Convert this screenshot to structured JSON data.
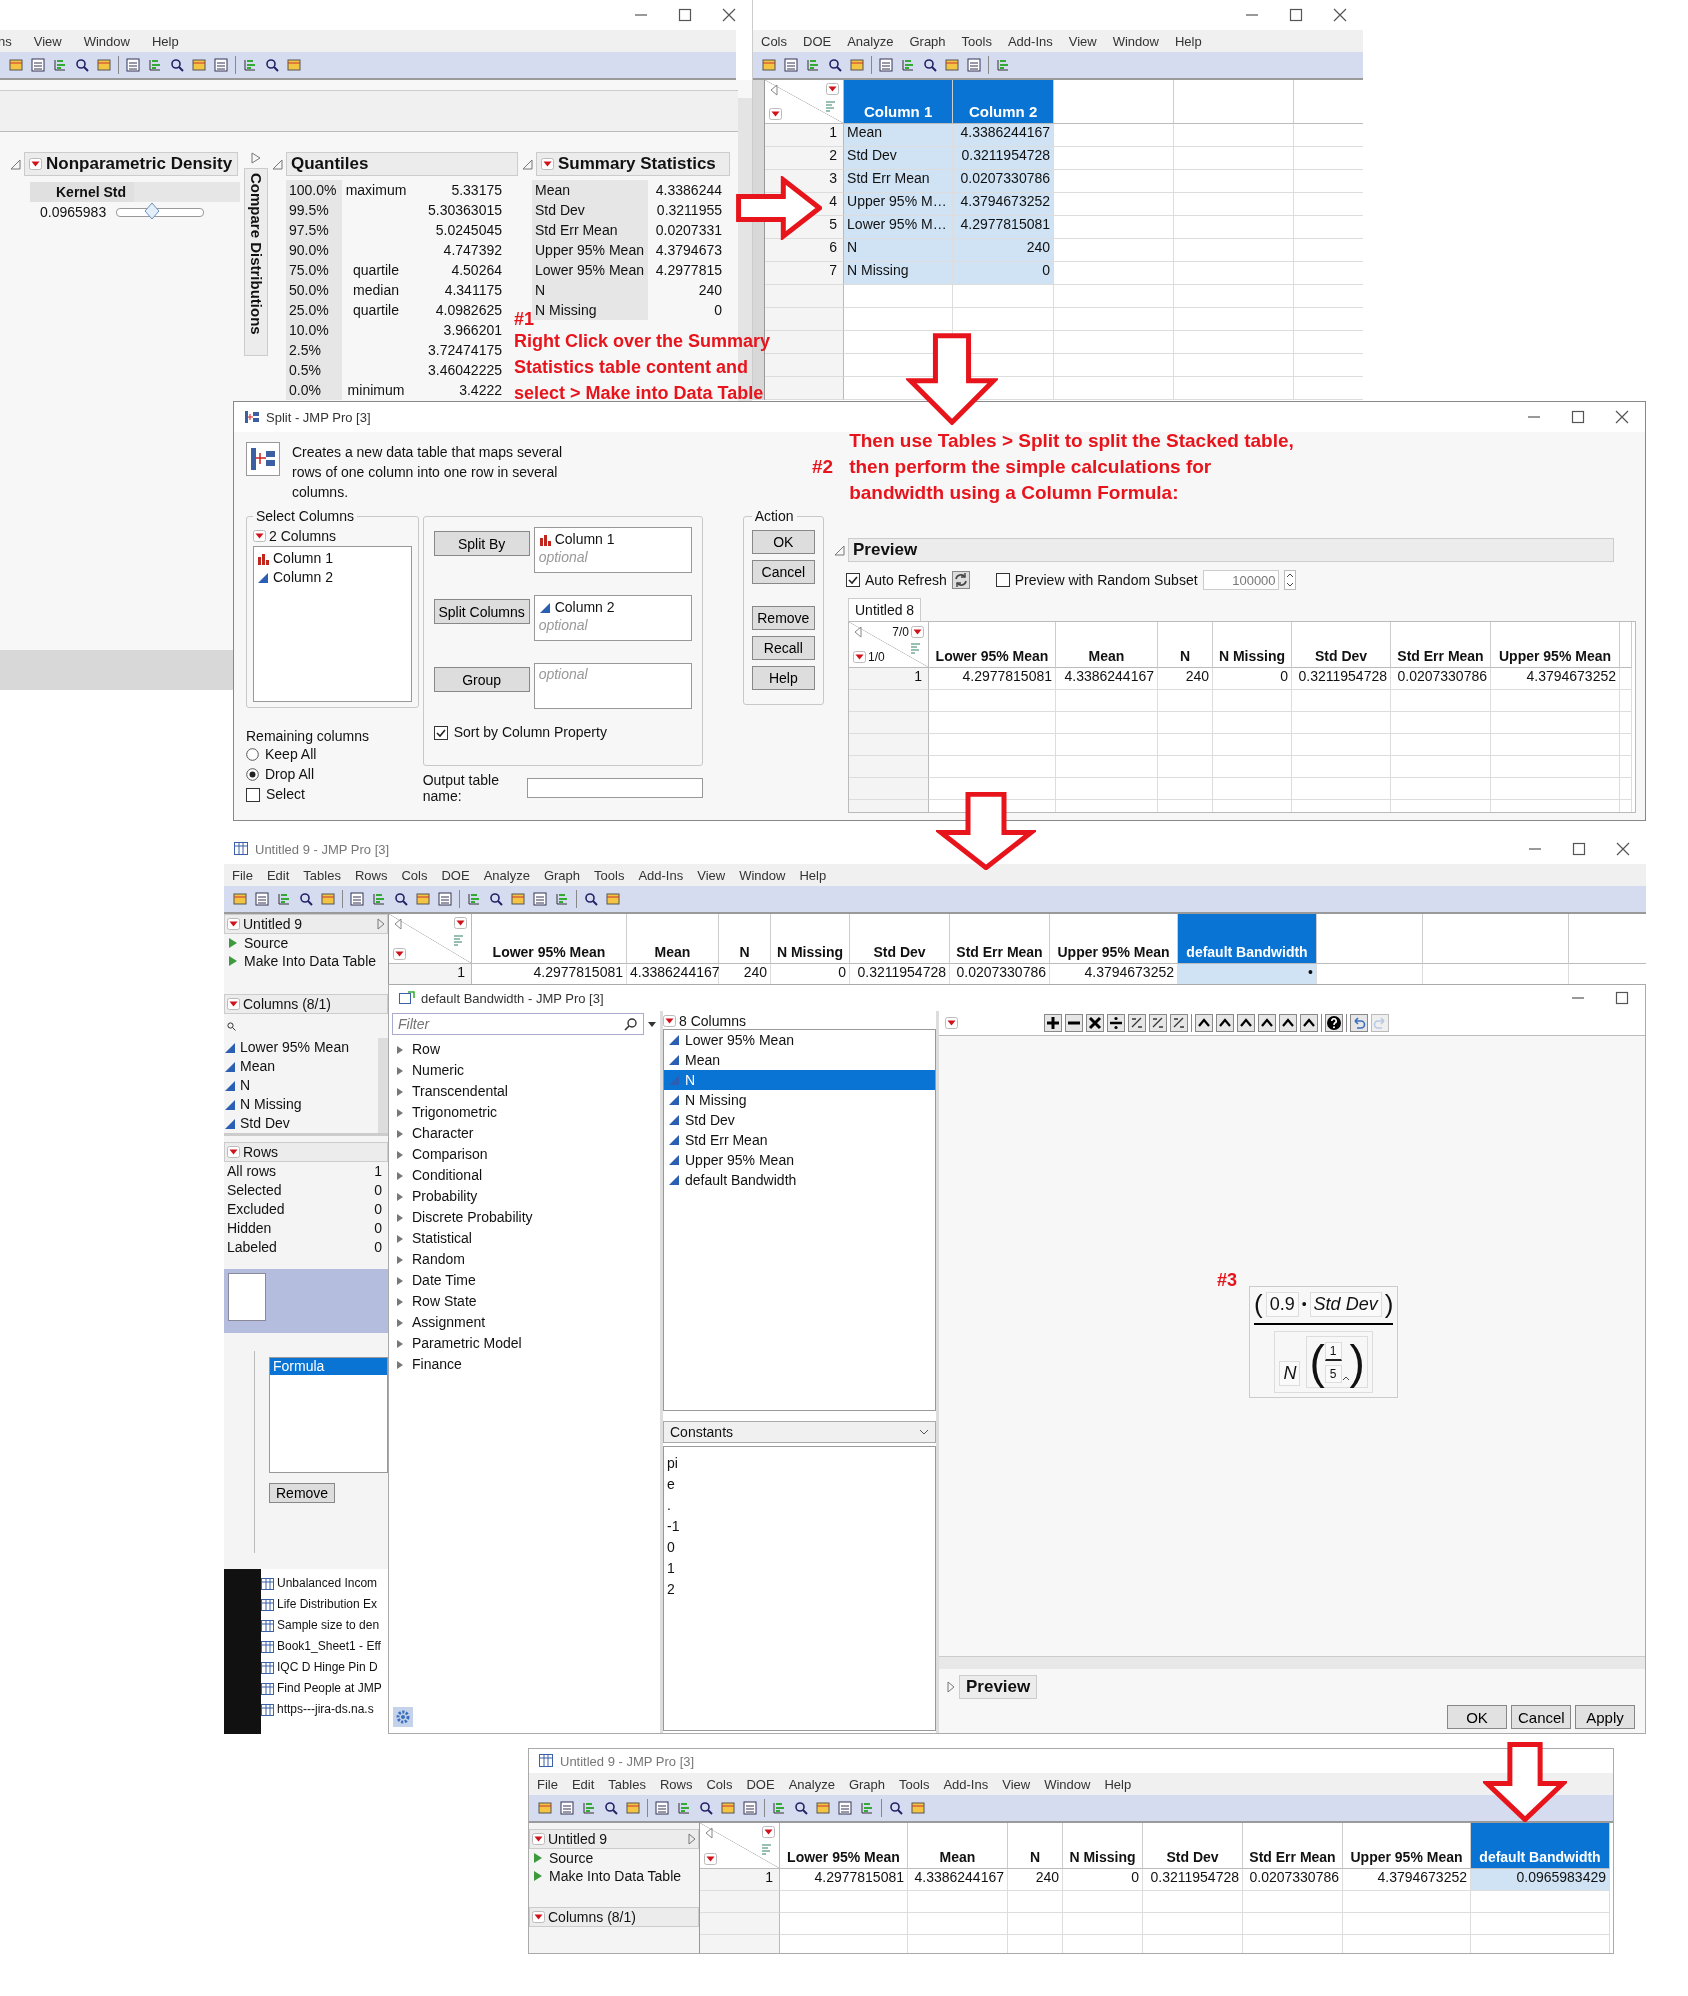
{
  "distribution_window": {
    "menu": [
      "ns",
      "View",
      "Window",
      "Help"
    ],
    "nonparametric_density": {
      "title": "Nonparametric Density",
      "kernel_label": "Kernel Std",
      "kernel_value": "0.0965983",
      "level": 0.4
    },
    "compare_distributions": "Compare Distributions",
    "quantiles": {
      "title": "Quantiles",
      "rows": [
        {
          "percent": "100.0%",
          "label": "maximum",
          "value": "5.33175"
        },
        {
          "percent": "99.5%",
          "value": "5.30363015"
        },
        {
          "percent": "97.5%",
          "value": "5.0245045"
        },
        {
          "percent": "90.0%",
          "value": "4.747392"
        },
        {
          "percent": "75.0%",
          "label": "quartile",
          "value": "4.50264"
        },
        {
          "percent": "50.0%",
          "label": "median",
          "value": "4.341175"
        },
        {
          "percent": "25.0%",
          "label": "quartile",
          "value": "4.0982625"
        },
        {
          "percent": "10.0%",
          "value": "3.966201"
        },
        {
          "percent": "2.5%",
          "value": "3.72474175"
        },
        {
          "percent": "0.5%",
          "value": "3.46042225"
        },
        {
          "percent": "0.0%",
          "label": "minimum",
          "value": "3.4222"
        }
      ]
    },
    "summary_statistics": {
      "title": "Summary Statistics",
      "rows": [
        {
          "label": "Mean",
          "value": "4.3386244"
        },
        {
          "label": "Std Dev",
          "value": "0.3211955"
        },
        {
          "label": "Std Err Mean",
          "value": "0.0207331"
        },
        {
          "label": "Upper 95% Mean",
          "value": "4.3794673"
        },
        {
          "label": "Lower 95% Mean",
          "value": "4.2977815"
        },
        {
          "label": "N",
          "value": "240"
        },
        {
          "label": "N Missing",
          "value": "0"
        }
      ]
    }
  },
  "stacked_table_window": {
    "menu": [
      "Cols",
      "DOE",
      "Analyze",
      "Graph",
      "Tools",
      "Add-Ins",
      "View",
      "Window",
      "Help"
    ],
    "table": {
      "columns": [
        {
          "name": "Column 1",
          "kind": "character",
          "selected": true
        },
        {
          "name": "Column 2",
          "kind": "numeric",
          "selected": true
        }
      ],
      "rows": [
        {
          "number": "1",
          "cells": [
            "Mean",
            "4.3386244167"
          ]
        },
        {
          "number": "2",
          "cells": [
            "Std Dev",
            "0.3211954728"
          ]
        },
        {
          "number": "3",
          "cells": [
            "Std Err Mean",
            "0.0207330786"
          ]
        },
        {
          "number": "4",
          "cells": [
            "Upper 95% M…",
            "4.3794673252"
          ]
        },
        {
          "number": "5",
          "cells": [
            "Lower 95% M…",
            "4.2977815081"
          ]
        },
        {
          "number": "6",
          "cells": [
            "N",
            "240"
          ]
        },
        {
          "number": "7",
          "cells": [
            "N Missing",
            "0"
          ]
        }
      ]
    }
  },
  "notes": [
    {
      "number": "#1",
      "lines": [
        "Right Click over the Summary",
        "Statistics table content and",
        "select > Make into Data Table"
      ]
    },
    {
      "number": "#2",
      "lines": [
        "Then use Tables > Split to split the Stacked table,",
        "then perform the simple calculations for",
        "bandwidth using a Column Formula:"
      ]
    },
    {
      "number": "#3"
    }
  ],
  "arrows": [
    {
      "kind": "right"
    },
    {
      "kind": "down"
    },
    {
      "kind": "down"
    },
    {
      "kind": "down"
    }
  ],
  "split_dialog": {
    "title": "Split - JMP Pro [3]",
    "description": "Creates a new data table that maps several rows of one column into one row in several columns.",
    "select_columns": {
      "legend": "Select Columns",
      "count": "2 Columns",
      "items": [
        {
          "name": "Column 1",
          "kind": "nominal"
        },
        {
          "name": "Column 2",
          "kind": "continuous"
        }
      ]
    },
    "roles": [
      {
        "button": "Split By",
        "items": [
          {
            "name": "Column 1",
            "kind": "nominal"
          }
        ],
        "hint": "optional"
      },
      {
        "button": "Split Columns",
        "items": [
          {
            "name": "Column 2",
            "kind": "continuous"
          }
        ],
        "hint": "optional"
      },
      {
        "button": "Group",
        "hint": "optional"
      }
    ],
    "sort_by_column_property": {
      "label": "Sort by Column Property",
      "checked": true
    },
    "remaining_columns": {
      "label": "Remaining columns",
      "options": [
        {
          "label": "Keep All",
          "selected": false
        },
        {
          "label": "Drop All",
          "selected": true
        }
      ]
    },
    "select_checkbox": {
      "label": "Select",
      "checked": false
    },
    "output_table_name": {
      "label": "Output table name:"
    },
    "action": {
      "legend": "Action",
      "buttons": [
        "OK",
        "Cancel",
        "Remove",
        "Recall",
        "Help"
      ]
    },
    "preview": {
      "title": "Preview",
      "auto_refresh": {
        "label": "Auto Refresh",
        "checked": true
      },
      "random_subset": {
        "label": "Preview with Random Subset",
        "checked": false,
        "value": "100000"
      },
      "tab": "Untitled 8",
      "table": {
        "corner_top": "7/0",
        "corner_bottom": "1/0",
        "columns": [
          {
            "name": "Lower 95% Mean",
            "selected": false
          },
          {
            "name": "Mean",
            "selected": false
          },
          {
            "name": "N",
            "selected": false
          },
          {
            "name": "N Missing",
            "selected": false
          },
          {
            "name": "Std Dev",
            "selected": false
          },
          {
            "name": "Std Err Mean",
            "selected": false
          },
          {
            "name": "Upper 95% Mean",
            "selected": false
          }
        ],
        "rows": [
          {
            "number": "1",
            "cells": [
              "4.2977815081",
              "4.3386244167",
              "240",
              "0",
              "0.3211954728",
              "0.0207330786",
              "4.3794673252"
            ]
          }
        ]
      }
    }
  },
  "untitled9_window": {
    "title": "Untitled 9 - JMP Pro [3]",
    "menu": [
      "File",
      "Edit",
      "Tables",
      "Rows",
      "Cols",
      "DOE",
      "Analyze",
      "Graph",
      "Tools",
      "Add-Ins",
      "View",
      "Window",
      "Help"
    ],
    "table_panel": {
      "name": "Untitled 9",
      "scripts": [
        "Source",
        "Make Into Data Table"
      ]
    },
    "columns_panel": {
      "title": "Columns (8/1)",
      "items": [
        {
          "name": "Lower 95% Mean",
          "kind": "continuous"
        },
        {
          "name": "Mean",
          "kind": "continuous"
        },
        {
          "name": "N",
          "kind": "continuous"
        },
        {
          "name": "N Missing",
          "kind": "continuous"
        },
        {
          "name": "Std Dev",
          "kind": "continuous"
        }
      ]
    },
    "rows_panel": {
      "title": "Rows",
      "items": [
        {
          "label": "All rows",
          "value": "1"
        },
        {
          "label": "Selected",
          "value": "0"
        },
        {
          "label": "Excluded",
          "value": "0"
        },
        {
          "label": "Hidden",
          "value": "0"
        },
        {
          "label": "Labeled",
          "value": "0"
        }
      ]
    },
    "formula_list": {
      "items": [
        {
          "label": "Formula",
          "selected": true
        }
      ],
      "button": "Remove"
    },
    "recent_files": [
      "Unbalanced Incom",
      "Life Distribution Ex",
      "Sample size to den",
      "Book1_Sheet1 - Eff",
      "IQC D Hinge Pin D",
      "Find People at JMP",
      "https---jira-ds.na.s"
    ],
    "table": {
      "columns": [
        {
          "name": "Lower 95% Mean",
          "selected": false
        },
        {
          "name": "Mean",
          "selected": false
        },
        {
          "name": "N",
          "selected": false
        },
        {
          "name": "N Missing",
          "selected": false
        },
        {
          "name": "Std Dev",
          "selected": false
        },
        {
          "name": "Std Err Mean",
          "selected": false
        },
        {
          "name": "Upper 95% Mean",
          "selected": false
        },
        {
          "name": "default Bandwidth",
          "selected": true
        }
      ],
      "rows": [
        {
          "number": "1",
          "cells": [
            "4.2977815081",
            "4.3386244167",
            "240",
            "0",
            "0.3211954728",
            "0.0207330786",
            "4.3794673252",
            "•"
          ]
        }
      ]
    }
  },
  "formula_editor": {
    "title": "default Bandwidth - JMP Pro [3]",
    "filter": {
      "placeholder": "Filter"
    },
    "function_groups": [
      "Row",
      "Numeric",
      "Transcendental",
      "Trigonometric",
      "Character",
      "Comparison",
      "Conditional",
      "Probability",
      "Discrete Probability",
      "Statistical",
      "Random",
      "Date Time",
      "Row State",
      "Assignment",
      "Parametric Model",
      "Finance"
    ],
    "columns_header": "8 Columns",
    "columns": [
      {
        "name": "Lower 95% Mean",
        "selected": false
      },
      {
        "name": "Mean",
        "selected": false
      },
      {
        "name": "N",
        "selected": true
      },
      {
        "name": "N Missing",
        "selected": false
      },
      {
        "name": "Std Dev",
        "selected": false
      },
      {
        "name": "Std Err Mean",
        "selected": false
      },
      {
        "name": "Upper 95% Mean",
        "selected": false
      },
      {
        "name": "default Bandwidth",
        "selected": false
      }
    ],
    "constants_menu": "Constants",
    "constants": [
      "pi",
      "e",
      ".",
      "-1",
      "0",
      "1",
      "2"
    ],
    "formula": {
      "open": "(",
      "coefficient": "0.9",
      "operator": "•",
      "variable": "Std Dev",
      "close": ")",
      "base": "N",
      "exponent_open": "(",
      "exponent_numerator": "1",
      "exponent_denominator": "5",
      "exponent_close": ")"
    },
    "preview": "Preview",
    "buttons": [
      "OK",
      "Cancel",
      "Apply"
    ]
  },
  "result_window": {
    "title": "Untitled 9 - JMP Pro [3]",
    "menu": [
      "File",
      "Edit",
      "Tables",
      "Rows",
      "Cols",
      "DOE",
      "Analyze",
      "Graph",
      "Tools",
      "Add-Ins",
      "View",
      "Window",
      "Help"
    ],
    "table_panel": {
      "name": "Untitled 9",
      "scripts": [
        "Source",
        "Make Into Data Table"
      ]
    },
    "columns_panel": {
      "title": "Columns (8/1)"
    },
    "table": {
      "columns": [
        {
          "name": "Lower 95% Mean",
          "selected": false
        },
        {
          "name": "Mean",
          "selected": false
        },
        {
          "name": "N",
          "selected": false
        },
        {
          "name": "N Missing",
          "selected": false
        },
        {
          "name": "Std Dev",
          "selected": false
        },
        {
          "name": "Std Err Mean",
          "selected": false
        },
        {
          "name": "Upper 95% Mean",
          "selected": false
        },
        {
          "name": "default Bandwidth",
          "selected": true
        }
      ],
      "rows": [
        {
          "number": "1",
          "cells": [
            "4.2977815081",
            "4.3386244167",
            "240",
            "0",
            "0.3211954728",
            "0.0207330786",
            "4.3794673252",
            "0.0965983429"
          ]
        }
      ]
    }
  }
}
